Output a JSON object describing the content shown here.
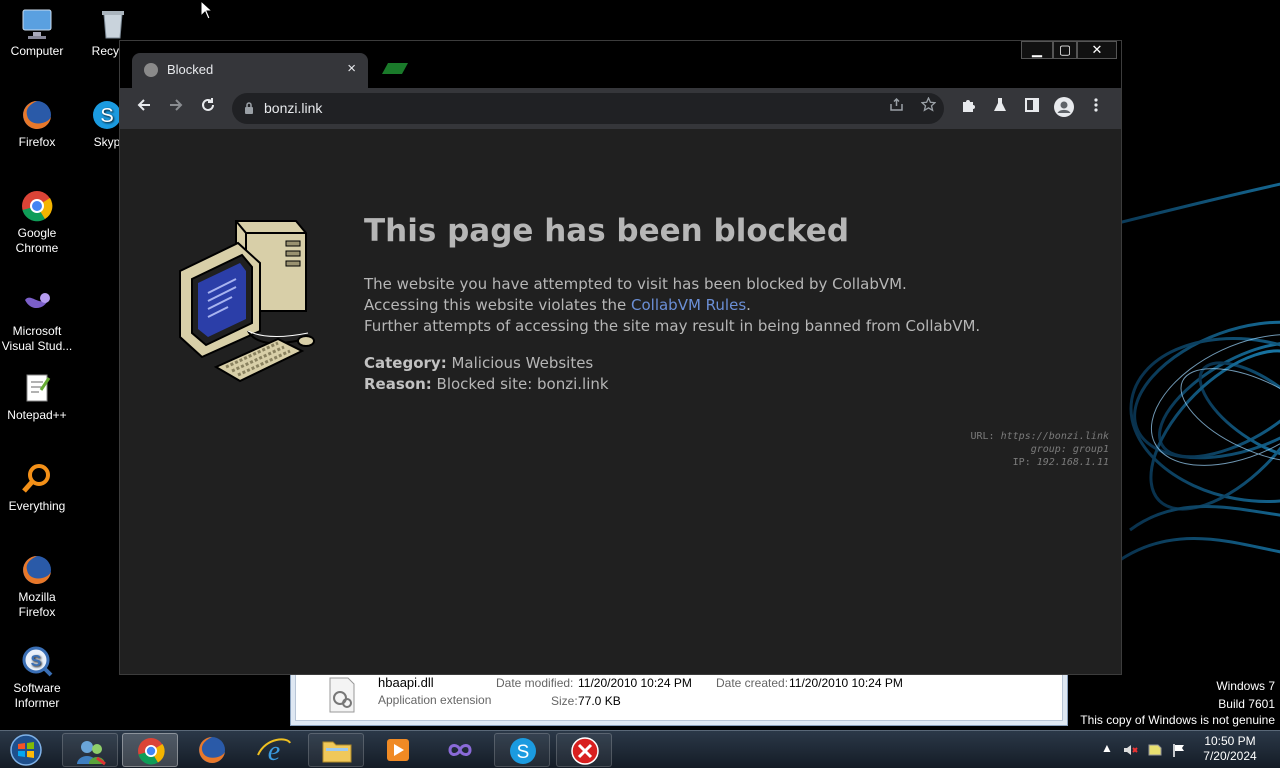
{
  "desktop": {
    "icons": [
      {
        "label": "Computer"
      },
      {
        "label": "Recycle"
      },
      {
        "label": "Firefox"
      },
      {
        "label": "Skyp"
      },
      {
        "label": "Google Chrome"
      },
      {
        "label": "Microsoft Visual Stud..."
      },
      {
        "label": "Notepad++"
      },
      {
        "label": "Everything"
      },
      {
        "label": "Mozilla Firefox"
      },
      {
        "label": "Software Informer"
      }
    ]
  },
  "explorer": {
    "file_name": "hbaapi.dll",
    "file_type": "Application extension",
    "date_modified_label": "Date modified:",
    "date_modified": "11/20/2010 10:24 PM",
    "date_created_label": "Date created:",
    "date_created": "11/20/2010 10:24 PM",
    "size_label": "Size:",
    "size": "77.0 KB"
  },
  "browser": {
    "tab_title": "Blocked",
    "tab_close": "×",
    "url": "bonzi.link",
    "page": {
      "heading": "This page has been blocked",
      "line1": "The website you have attempted to visit has been blocked by CollabVM.",
      "line2_prefix": "Accessing this website violates the ",
      "line2_link": "CollabVM Rules",
      "line2_suffix": ".",
      "line3": "Further attempts of accessing the site may result in being banned from CollabVM.",
      "category_label": "Category:",
      "category_value": "Malicious Websites",
      "reason_label": "Reason:",
      "reason_value": "Blocked site: bonzi.link",
      "meta_url_key": "URL:",
      "meta_url": "https://bonzi.link",
      "meta_group_key": "group:",
      "meta_group": "group1",
      "meta_ip_key": "IP:",
      "meta_ip": "192.168.1.11"
    }
  },
  "watermark": {
    "line1": "Windows 7",
    "line2": "Build 7601",
    "line3": "This copy of Windows is not genuine"
  },
  "taskbar": {
    "time": "10:50 PM",
    "date": "7/20/2024"
  },
  "colors": {
    "page_bg": "#202020",
    "link": "#6b8fd6",
    "tab_bg": "#35363a"
  }
}
